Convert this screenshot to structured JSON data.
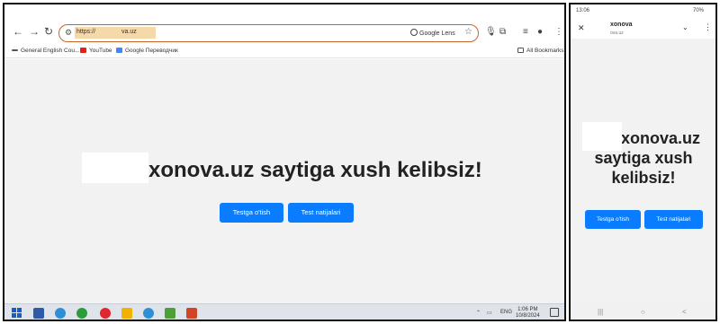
{
  "desktop": {
    "browser": {
      "nav": {
        "back": "←",
        "forward": "→",
        "reload": "↻"
      },
      "omnibox": {
        "url_prefix": "https://",
        "url_suffix": "va.uz",
        "lens_label": "Google Lens",
        "tune_icon": "tune-icon",
        "star_icon": "bookmark-star-icon"
      },
      "right_icons": {
        "mic": "mic-icon",
        "extensions": "extensions-icon",
        "profile": "profile-icon",
        "menu": "⋮"
      },
      "bookmarks": [
        {
          "label": "General English Cou...",
          "icon": "bookmark-generic-icon",
          "color": "#555555"
        },
        {
          "label": "YouTube",
          "icon": "youtube-icon",
          "color": "#e62117"
        },
        {
          "label": "Google Переводчик",
          "icon": "google-translate-icon",
          "color": "#4285f4"
        }
      ],
      "all_bookmarks": "All Bookmarks"
    },
    "page": {
      "title": "xonova.uz saytiga xush kelibsiz!",
      "buttons": [
        "Testga o'tish",
        "Test natijalari"
      ]
    },
    "taskbar": {
      "language": "ENG",
      "time": "1:06 PM",
      "date": "10/8/2024"
    }
  },
  "phone": {
    "status": {
      "time": "13:06",
      "battery": "70%"
    },
    "header": {
      "site": "xonova",
      "url": "ova.uz",
      "back": "✕",
      "chevron": "⌄",
      "menu": "⋮"
    },
    "page": {
      "title_lines": [
        "xonova.uz",
        "saytiga xush",
        "kelibsiz!"
      ],
      "buttons": [
        "Testga o'tish",
        "Test natijalari"
      ]
    },
    "navbar": {
      "recents": "|||",
      "home": "○",
      "back": "<"
    }
  },
  "colors": {
    "accent": "#0a7cff",
    "omnibox_border": "#c8642a",
    "page_bg": "#f2f2f2"
  }
}
